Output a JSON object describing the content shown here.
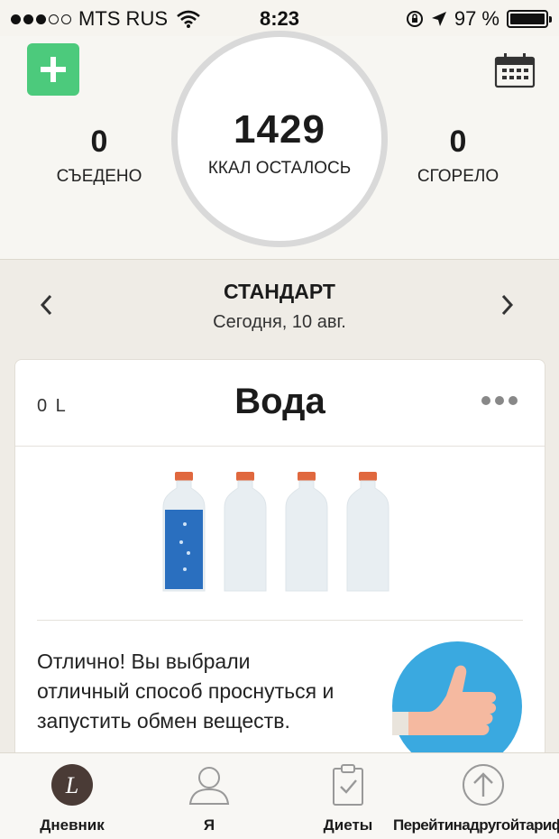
{
  "status_bar": {
    "carrier": "MTS RUS",
    "time": "8:23",
    "battery": "97 %",
    "signal_bars": [
      true,
      true,
      true,
      false,
      false
    ]
  },
  "summary": {
    "add_button_icon": "plus-icon",
    "calendar_icon": "calendar-icon",
    "eaten_value": "0",
    "eaten_label": "СЪЕДЕНО",
    "remaining_value": "1429",
    "remaining_label": "ККАЛ ОСТАЛОСЬ",
    "burned_value": "0",
    "burned_label": "СГОРЕЛО"
  },
  "day_nav": {
    "diet": "СТАНДАРТ",
    "date": "Сегодня, 10 авг.",
    "prev_icon": "chevron-left-icon",
    "next_icon": "chevron-right-icon"
  },
  "water_card": {
    "amount": "0 L",
    "title": "Вода",
    "more_icon": "more-icon",
    "bottles": [
      {
        "filled": true
      },
      {
        "filled": false
      },
      {
        "filled": false
      },
      {
        "filled": false
      }
    ],
    "message": "Отлично! Вы выбрали отличный способ проснуться и запустить обмен веществ."
  },
  "tabbar": {
    "tabs": [
      {
        "label": "Дневник",
        "icon": "diary-icon"
      },
      {
        "label": "Я",
        "icon": "person-icon"
      },
      {
        "label": "Диеты",
        "icon": "clipboard-icon"
      },
      {
        "label": "Перейтинадругойтариф",
        "icon": "upgrade-arrow-icon"
      }
    ]
  },
  "colors": {
    "accent_green": "#4cca7c",
    "water_blue": "#2a6fbf",
    "cap_orange": "#e0683e",
    "thumb_circle": "#3aa9e0"
  }
}
